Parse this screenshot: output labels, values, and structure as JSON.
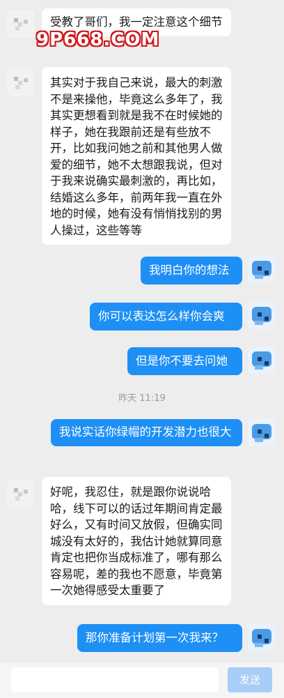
{
  "watermark": "9P668.COM",
  "messages": [
    {
      "side": "left",
      "text": "受教了哥们，我一定注意这个细节"
    },
    {
      "side": "left",
      "text": "其实对于我自己来说，最大的刺激不是来操他，毕竟这么多年了，我其实更想看到就是我不在时候她的样子，她在我跟前还是有些放不开，比如我问她之前和其他男人做爱的细节，她不太想跟我说，但对于我来说确实最刺激的，再比如，结婚这么多年，前两年我一直在外地的时候，她有没有悄悄找别的男人操过，这些等等"
    },
    {
      "side": "right",
      "text": "我明白你的想法"
    },
    {
      "side": "right",
      "text": "你可以表达怎么样你会爽"
    },
    {
      "side": "right",
      "text": "但是你不要去问她"
    },
    {
      "side": "right",
      "text": "我说实话你绿帽的开发潜力也很大"
    },
    {
      "side": "left",
      "text": "好呢，我忍住，就是跟你说说哈哈，线下可以的话过年期间肯定最好么，又有时间又放假，但确实同城没有太好的，我估计她就算同意肯定也把你当成标准了，哪有那么容易呢，差的我也不愿意，毕竟第一次她得感受太重要了"
    },
    {
      "side": "right",
      "text": "那你准备计划第一次我来？"
    }
  ],
  "timestamp": "昨天 11:19",
  "input": {
    "send_label": "发送"
  },
  "colors": {
    "sent_bubble": "#1e8ff5",
    "received_bubble": "#ffffff",
    "background": "#ededed",
    "send_button": "#a8cdf6"
  }
}
